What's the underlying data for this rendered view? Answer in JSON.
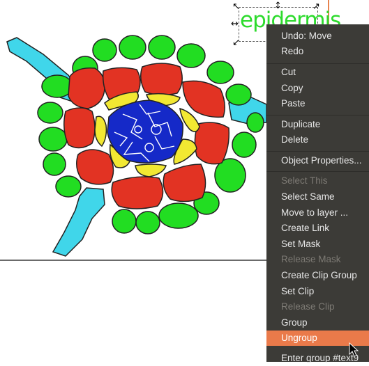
{
  "canvas": {
    "label_text": "epidermis",
    "colors": {
      "epidermis": "#22dd22",
      "cortex": "#e23323",
      "endodermis": "#f2e832",
      "vascular": "#1529c8",
      "root_hair": "#40d6ea",
      "menu_bg": "#3c3b37",
      "menu_highlight": "#ea7a4a"
    }
  },
  "context_menu": {
    "items": [
      {
        "label": "Undo: Move",
        "disabled": false
      },
      {
        "label": "Redo",
        "disabled": false
      },
      {
        "label": "Cut",
        "disabled": false
      },
      {
        "label": "Copy",
        "disabled": false
      },
      {
        "label": "Paste",
        "disabled": false
      },
      {
        "label": "Duplicate",
        "disabled": false
      },
      {
        "label": "Delete",
        "disabled": false
      },
      {
        "label": "Object Properties...",
        "disabled": false
      },
      {
        "label": "Select This",
        "disabled": true
      },
      {
        "label": "Select Same",
        "disabled": false
      },
      {
        "label": "Move to layer ...",
        "disabled": false
      },
      {
        "label": "Create Link",
        "disabled": false
      },
      {
        "label": "Set Mask",
        "disabled": false
      },
      {
        "label": "Release Mask",
        "disabled": true
      },
      {
        "label": "Create Clip Group",
        "disabled": false
      },
      {
        "label": "Set Clip",
        "disabled": false
      },
      {
        "label": "Release Clip",
        "disabled": true
      },
      {
        "label": "Group",
        "disabled": false
      },
      {
        "label": "Ungroup",
        "disabled": false,
        "highlighted": true
      },
      {
        "label": "Enter group #text9",
        "disabled": false
      }
    ]
  }
}
